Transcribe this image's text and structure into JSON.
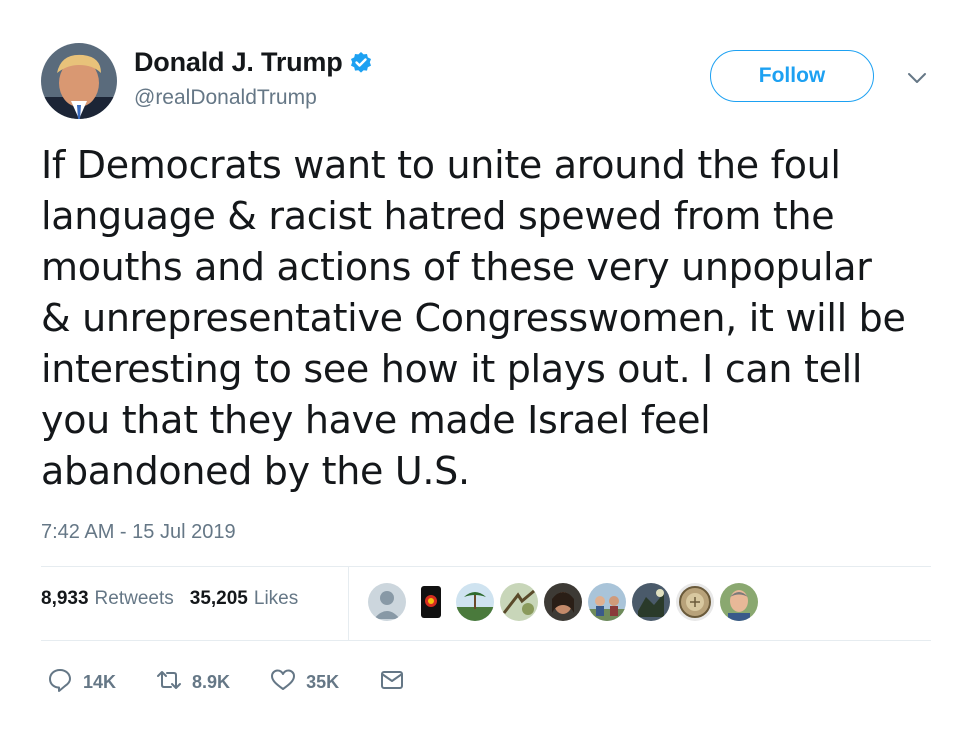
{
  "author": {
    "display_name": "Donald J. Trump",
    "handle": "@realDonaldTrump",
    "verified": true
  },
  "follow_label": "Follow",
  "tweet": {
    "lines": [
      "If Democrats want to unite around the foul",
      "language & racist hatred spewed from the",
      "mouths and actions of these very unpopular",
      "& unrepresentative Congresswomen, it will be",
      "interesting to see how it plays out. I can tell",
      "you that they have made Israel feel",
      "abandoned by the U.S."
    ]
  },
  "timestamp": "7:42 AM - 15 Jul 2019",
  "stats": {
    "retweets_count": "8,933",
    "retweets_label": "Retweets",
    "likes_count": "35,205",
    "likes_label": "Likes"
  },
  "actions": {
    "reply_count": "14K",
    "retweet_count": "8.9K",
    "like_count": "35K"
  },
  "colors": {
    "accent": "#1da1f2",
    "secondary_text": "#657786",
    "divider": "#e6ecf0"
  },
  "icons": [
    "verified-badge-icon",
    "chevron-down-icon",
    "reply-icon",
    "retweet-icon",
    "like-icon",
    "direct-message-icon"
  ]
}
